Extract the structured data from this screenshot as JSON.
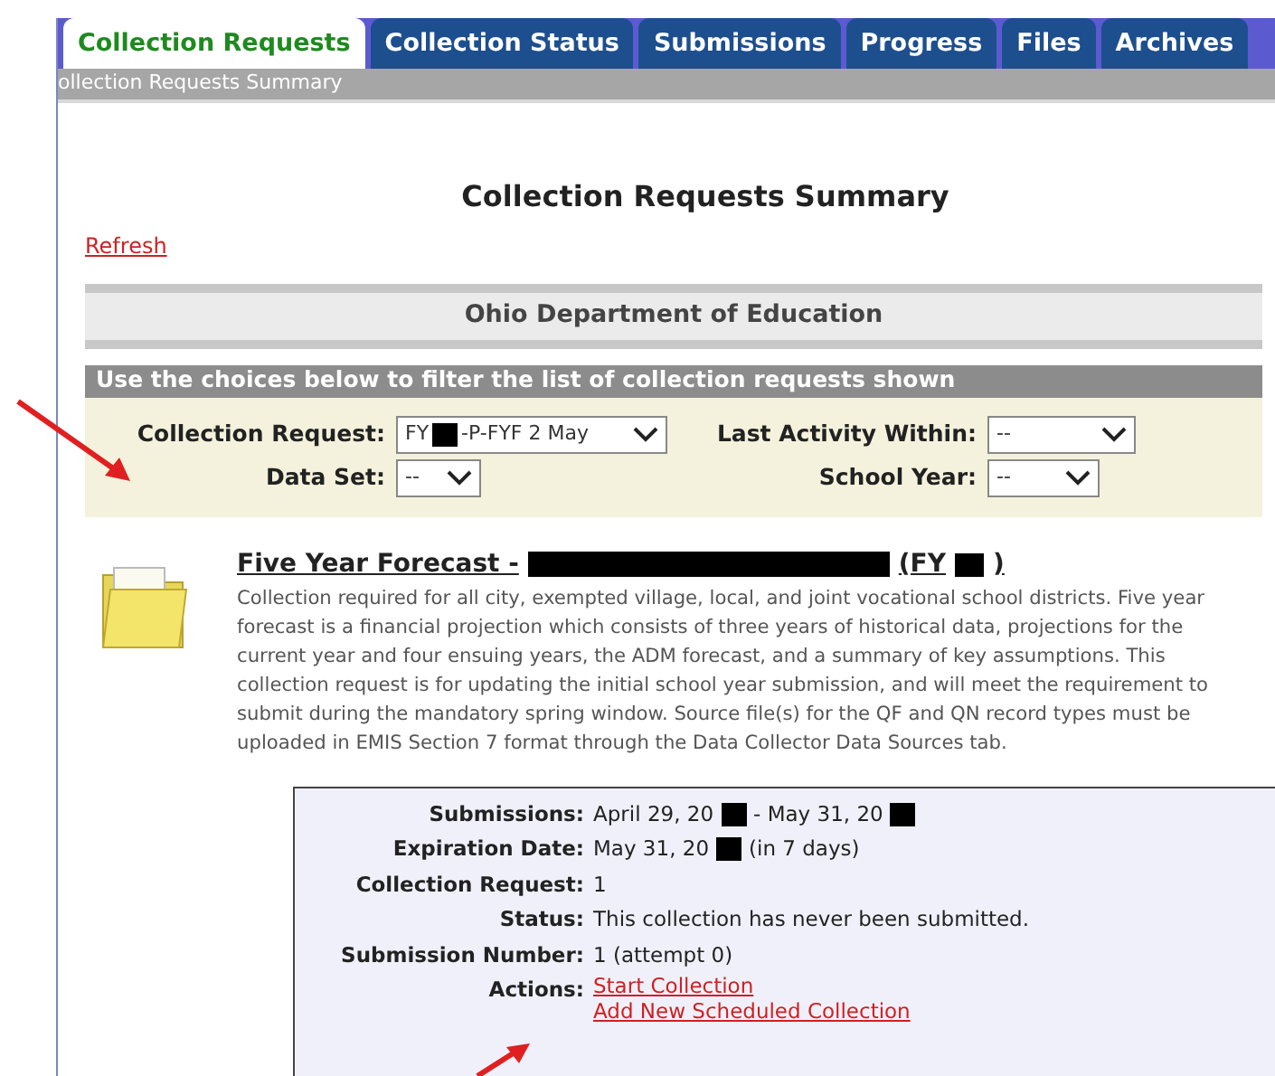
{
  "tabs": [
    {
      "label": "Collection Requests",
      "selected": true
    },
    {
      "label": "Collection Status",
      "selected": false
    },
    {
      "label": "Submissions",
      "selected": false
    },
    {
      "label": "Progress",
      "selected": false
    },
    {
      "label": "Files",
      "selected": false
    },
    {
      "label": "Archives",
      "selected": false
    }
  ],
  "breadcrumb": "ollection Requests Summary",
  "page_title": "Collection Requests Summary",
  "refresh_link": "Refresh",
  "organization": "Ohio Department of Education",
  "filter": {
    "header": "Use the choices below to filter the list of collection requests shown",
    "fields": [
      {
        "label": "Collection Request:",
        "value": [
          {
            "kind": "text",
            "text": "FY"
          },
          {
            "kind": "redacted"
          },
          {
            "kind": "text",
            "text": "-P-FYF 2 May"
          }
        ]
      },
      {
        "label": "Last Activity Within:",
        "value": [
          {
            "kind": "text",
            "text": "--"
          }
        ]
      },
      {
        "label": "Data Set:",
        "value": [
          {
            "kind": "text",
            "text": "--"
          }
        ]
      },
      {
        "label": "School Year:",
        "value": [
          {
            "kind": "text",
            "text": "--"
          }
        ]
      }
    ]
  },
  "collection": {
    "title": [
      {
        "kind": "text",
        "text": "Five Year Forecast -"
      },
      {
        "kind": "redacted_long"
      },
      {
        "kind": "text",
        "text": "(FY"
      },
      {
        "kind": "redacted"
      },
      {
        "kind": "text",
        "text": ")"
      }
    ],
    "description": "Collection required for all city, exempted village, local, and joint vocational school districts. Five year forecast is a financial projection which consists of three years of historical data, projections for the current year and four ensuing years, the ADM forecast, and a summary of key assumptions. This collection request is for updating the initial school year submission, and will meet the requirement to submit during the mandatory spring window. Source file(s) for the QF and QN record types must be uploaded in EMIS Section 7 format through the Data Collector Data Sources tab.",
    "details": [
      {
        "label": "Submissions:",
        "value": [
          {
            "kind": "text",
            "text": "April 29, 20"
          },
          {
            "kind": "redacted"
          },
          {
            "kind": "text",
            "text": "- May 31, 20"
          },
          {
            "kind": "redacted"
          }
        ]
      },
      {
        "label": "Expiration Date:",
        "value": [
          {
            "kind": "text",
            "text": "May 31, 20"
          },
          {
            "kind": "redacted"
          },
          {
            "kind": "text",
            "text": "(in 7 days)"
          }
        ]
      },
      {
        "label": "Collection Request:",
        "value": [
          {
            "kind": "text",
            "text": "1"
          }
        ]
      },
      {
        "label": "Status:",
        "value": [
          {
            "kind": "text",
            "text": "This collection has never been submitted."
          }
        ]
      },
      {
        "label": "Submission Number:",
        "value": [
          {
            "kind": "text",
            "text": "1 (attempt 0)"
          }
        ]
      }
    ],
    "actions_label": "Actions:",
    "actions": [
      "Start Collection",
      "Add New Scheduled Collection"
    ]
  }
}
